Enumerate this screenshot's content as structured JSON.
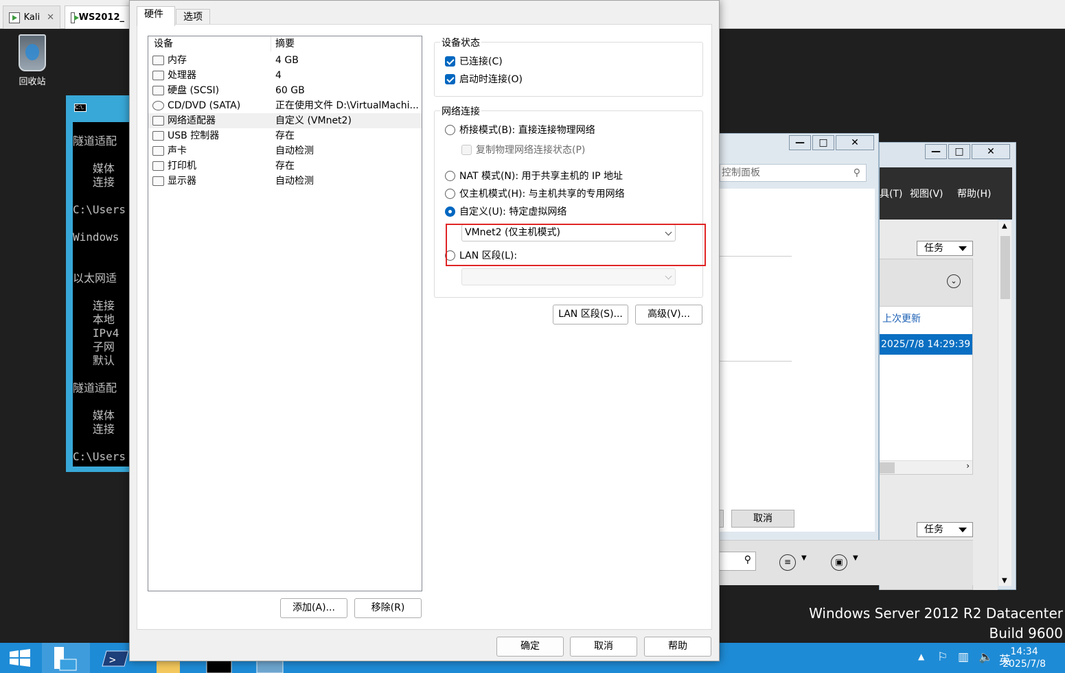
{
  "vmware_tabs": [
    {
      "label": "Kali",
      "active": false
    },
    {
      "label": "WS2012_",
      "active": true
    }
  ],
  "desktop": {
    "recycle_bin_label": "回收站",
    "os_edition": "Windows Server 2012 R2 Datacenter",
    "os_build": "Build 9600"
  },
  "console": {
    "icon_text": "C:\\.",
    "lines": "隧道适配\n\n   媒体\n   连接\n\nC:\\Users\n\nWindows \n\n\n以太网适\n\n   连接\n   本地\n   IPv4\n   子网\n   默认\n\n隧道适配\n\n   媒体\n   连接\n\nC:\\Users"
  },
  "control_panel": {
    "minimize": "—",
    "maximize": "□",
    "close": "✕",
    "search_placeholder": "控制面板",
    "cancel_label": "取消"
  },
  "server_manager": {
    "minimize": "—",
    "maximize": "□",
    "close": "✕",
    "menu_partial": "具(T)",
    "menu_view": "视图(V)",
    "menu_help": "帮助(H)",
    "tasks_label": "任务",
    "tasks_label_2": "任务",
    "last_update_header": "上次更新",
    "last_update_value": "2025/7/8 14:29:39"
  },
  "dialog": {
    "tabs": [
      "硬件",
      "选项"
    ],
    "device_header": {
      "device": "设备",
      "summary": "摘要"
    },
    "devices": [
      {
        "name": "内存",
        "summary": "4 GB",
        "icon": "memory-icon"
      },
      {
        "name": "处理器",
        "summary": "4",
        "icon": "cpu-icon"
      },
      {
        "name": "硬盘 (SCSI)",
        "summary": "60 GB",
        "icon": "harddisk-icon"
      },
      {
        "name": "CD/DVD (SATA)",
        "summary": "正在使用文件 D:\\VirtualMachi...",
        "icon": "cdrom-icon"
      },
      {
        "name": "网络适配器",
        "summary": "自定义 (VMnet2)",
        "icon": "network-adapter-icon"
      },
      {
        "name": "USB 控制器",
        "summary": "存在",
        "icon": "usb-icon"
      },
      {
        "name": "声卡",
        "summary": "自动检测",
        "icon": "speaker-icon"
      },
      {
        "name": "打印机",
        "summary": "存在",
        "icon": "printer-icon"
      },
      {
        "name": "显示器",
        "summary": "自动检测",
        "icon": "monitor-icon"
      }
    ],
    "selected_device_index": 4,
    "add_button": "添加(A)...",
    "remove_button": "移除(R)",
    "device_status": {
      "title": "设备状态",
      "connected": "已连接(C)",
      "connect_at_power_on": "启动时连接(O)"
    },
    "network_connection": {
      "title": "网络连接",
      "bridged": "桥接模式(B): 直接连接物理网络",
      "replicate_state": "复制物理网络连接状态(P)",
      "nat": "NAT 模式(N): 用于共享主机的 IP 地址",
      "host_only": "仅主机模式(H): 与主机共享的专用网络",
      "custom": "自定义(U): 特定虚拟网络",
      "custom_selected_value": "VMnet2 (仅主机模式)",
      "lan_segment": "LAN 区段(L):",
      "lan_segment_value": ""
    },
    "lan_segments_button": "LAN 区段(S)...",
    "advanced_button": "高级(V)...",
    "ok_button": "确定",
    "cancel_button": "取消",
    "help_button": "帮助",
    "highlight_color": "#e02424"
  },
  "taskbar": {
    "tray_lang": "英",
    "clock_time": "14:34",
    "clock_date": "2025/7/8",
    "accent": "#1e8bd6"
  }
}
